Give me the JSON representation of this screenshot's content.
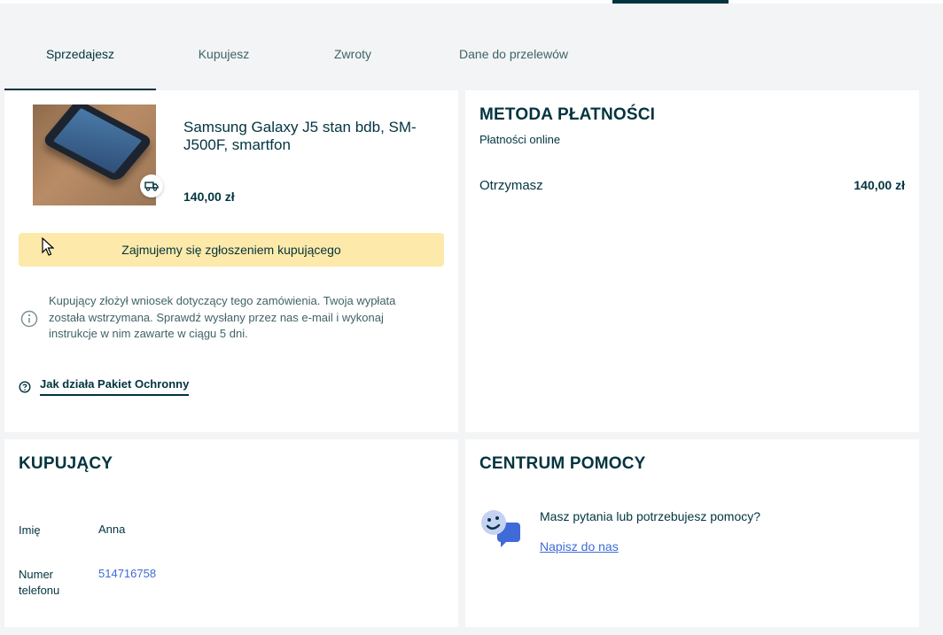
{
  "tabs": [
    {
      "label": "Sprzedajesz",
      "active": true
    },
    {
      "label": "Kupujesz",
      "active": false
    },
    {
      "label": "Zwroty",
      "active": false
    },
    {
      "label": "Dane do przelewów",
      "active": false
    }
  ],
  "product": {
    "title": "Samsung Galaxy J5 stan bdb, SM-J500F, smartfon",
    "price": "140,00 zł",
    "image_icon": "smartphone-photo",
    "badge_icon": "delivery-truck-icon"
  },
  "status": {
    "banner": "Zajmujemy się zgłoszeniem kupującego",
    "info_icon": "info-icon",
    "info_text": "Kupujący złożył wniosek dotyczący tego zamówienia. Twoja wypłata została wstrzymana. Sprawdź wysłany przez nas e-mail i wykonaj instrukcje w nim zawarte w ciągu 5 dni.",
    "protection_link": "Jak działa Pakiet Ochronny",
    "protection_icon": "question-circle-icon"
  },
  "payment": {
    "title": "METODA PŁATNOŚCI",
    "method": "Płatności online",
    "receive_label": "Otrzymasz",
    "receive_value": "140,00 zł"
  },
  "buyer": {
    "title": "KUPUJĄCY",
    "name_label": "Imię",
    "name_value": "Anna",
    "phone_label": "Numer telefonu",
    "phone_value": "514716758"
  },
  "help": {
    "title": "CENTRUM POMOCY",
    "question": "Masz pytania lub potrzebujesz pomocy?",
    "link": "Napisz do nas",
    "icon": "chat-bubbles-icon"
  },
  "colors": {
    "primary_text": "#02343f",
    "link": "#3f6ad8",
    "banner_bg": "#fde9a9",
    "page_bg": "#f2f4f5"
  }
}
